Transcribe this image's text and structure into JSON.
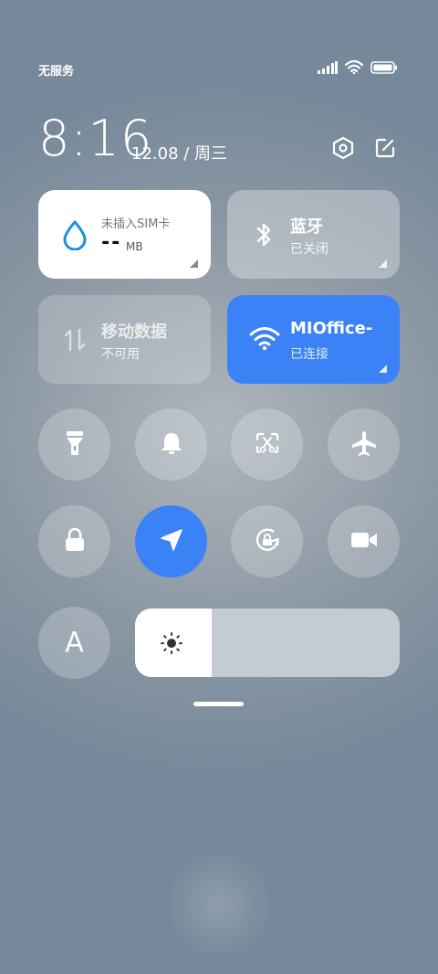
{
  "status_bar": {
    "carrier": "无服务"
  },
  "header": {
    "time": "8:16",
    "date": "12.08 / 周三"
  },
  "tiles": {
    "data_usage": {
      "title": "未插入SIM卡",
      "value": "--",
      "unit": "MB"
    },
    "bluetooth": {
      "title": "蓝牙",
      "status": "已关闭"
    },
    "mobile_data": {
      "title": "移动数据",
      "status": "不可用"
    },
    "wifi": {
      "title": "MIOffice-",
      "status": "已连接"
    }
  },
  "toggles_row1": [
    "flashlight-icon",
    "bell-icon",
    "screenshot-icon",
    "airplane-icon"
  ],
  "toggles_row2": [
    "lock-icon",
    "location-icon",
    "rotation-lock-icon",
    "video-icon"
  ],
  "auto_brightness_label": "A",
  "brightness": {
    "level": 0.29
  },
  "colors": {
    "accent": "#3b82f6",
    "wifi_icon": "#3b82f6",
    "data_icon": "#1a8fe3"
  }
}
